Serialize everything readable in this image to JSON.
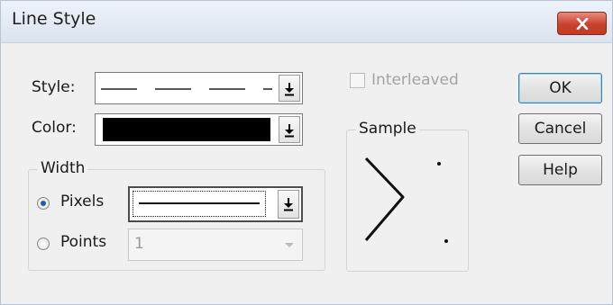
{
  "dialog": {
    "title": "Line Style",
    "close_icon": "close-x-icon"
  },
  "style": {
    "label": "Style:",
    "selected": "dashed line"
  },
  "color": {
    "label": "Color:",
    "selected": "#000000"
  },
  "interleaved": {
    "label": "Interleaved",
    "checked": false,
    "enabled": false
  },
  "width_group": {
    "title": "Width",
    "pixels_label": "Pixels",
    "points_label": "Points",
    "selected_unit": "Pixels",
    "pixels_selected": "solid line",
    "points_value": "1"
  },
  "sample": {
    "title": "Sample"
  },
  "buttons": {
    "ok": "OK",
    "cancel": "Cancel",
    "help": "Help"
  },
  "colors": {
    "accent": "#1f5fa8",
    "close_button": "#c9412d"
  }
}
